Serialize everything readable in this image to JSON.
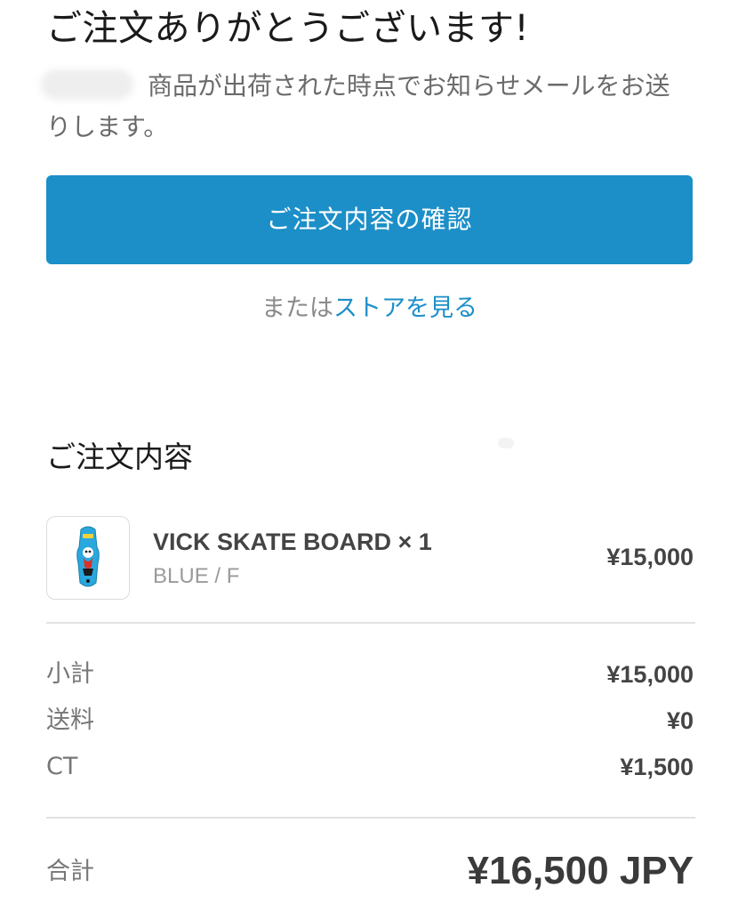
{
  "header": {
    "title": "ご注文ありがとうございます!",
    "notice": "商品が出荷された時点でお知らせメールをお送りします。"
  },
  "actions": {
    "confirm_label": "ご注文内容の確認",
    "or_text": "または",
    "store_link_label": "ストアを見る"
  },
  "order": {
    "section_title": "ご注文内容",
    "item": {
      "name": "VICK SKATE BOARD × 1",
      "variant": "BLUE / F",
      "price": "¥15,000",
      "thumbnail_icon": "skateboard-deck-image"
    },
    "summary": [
      {
        "label": "小計",
        "value": "¥15,000"
      },
      {
        "label": "送料",
        "value": "¥0"
      },
      {
        "label": "CT",
        "value": "¥1,500"
      }
    ],
    "total": {
      "label": "合計",
      "value": "¥16,500 JPY"
    }
  },
  "colors": {
    "accent": "#1c8fc8",
    "button_text": "#ffffff",
    "divider": "#e2e2e2",
    "deck": "#2aa7dd"
  }
}
